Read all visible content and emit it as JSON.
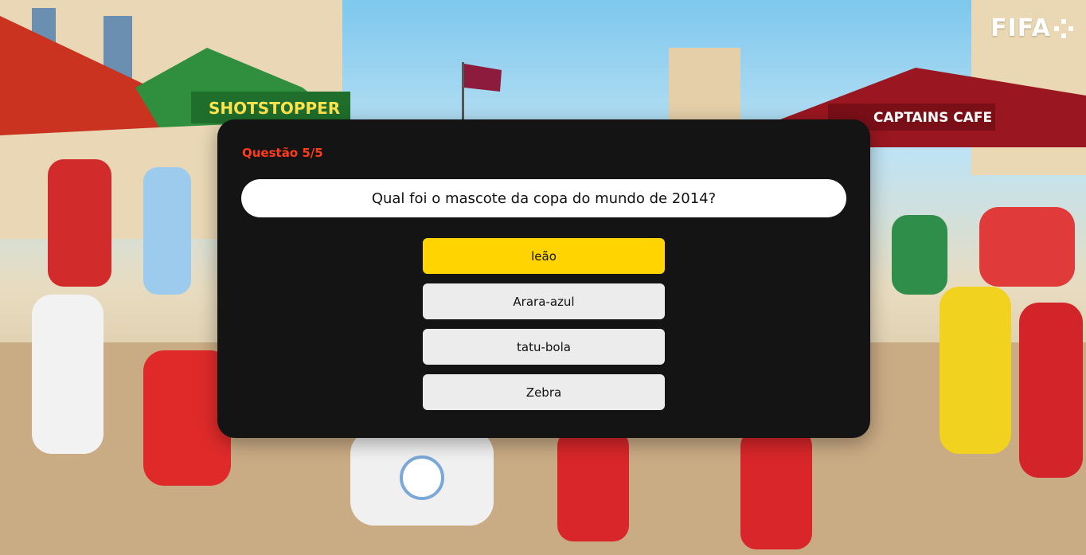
{
  "brand": {
    "logo_text": "FIFA",
    "logo_mark_icon": "fifa-plus-icon"
  },
  "quiz": {
    "counter": "Questão 5/5",
    "question": "Qual foi o mascote da copa do mundo de 2014?",
    "options": [
      {
        "label": "leão",
        "selected": true
      },
      {
        "label": "Arara-azul",
        "selected": false
      },
      {
        "label": "tatu-bola",
        "selected": false
      },
      {
        "label": "Zebra",
        "selected": false
      }
    ]
  },
  "background": {
    "signs": [
      "SHOTSTOPPER",
      "CAPTAINS CAFE"
    ]
  },
  "colors": {
    "accent": "#ff3b1a",
    "selected": "#ffd400",
    "option_bg": "#ececec",
    "panel_bg": "#141414"
  }
}
